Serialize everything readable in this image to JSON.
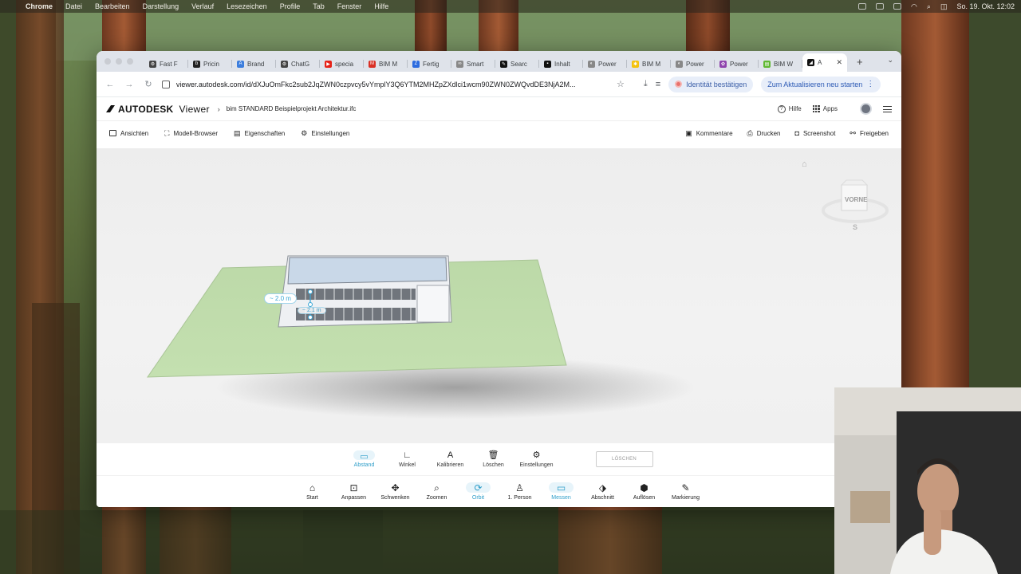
{
  "menubar": {
    "app": "Chrome",
    "items": [
      "Datei",
      "Bearbeiten",
      "Darstellung",
      "Verlauf",
      "Lesezeichen",
      "Profile",
      "Tab",
      "Fenster",
      "Hilfe"
    ],
    "datetime": "So. 19. Okt. 12:02"
  },
  "tabs": [
    {
      "label": "Fast F",
      "color": "#444444",
      "glyph": "⚙"
    },
    {
      "label": "Pricin",
      "color": "#222222",
      "glyph": "b"
    },
    {
      "label": "Brand",
      "color": "#3b7ddd",
      "glyph": "A"
    },
    {
      "label": "ChatG",
      "color": "#444444",
      "glyph": "⚙"
    },
    {
      "label": "specia",
      "color": "#e62117",
      "glyph": "▶"
    },
    {
      "label": "BIM M",
      "color": "#d93025",
      "glyph": "M"
    },
    {
      "label": "Fertig",
      "color": "#2d6cdf",
      "glyph": "Z"
    },
    {
      "label": "Smart",
      "color": "#888888",
      "glyph": "∞"
    },
    {
      "label": "Searc",
      "color": "#111111",
      "glyph": "✎"
    },
    {
      "label": "Inhalt",
      "color": "#111111",
      "glyph": "▪"
    },
    {
      "label": "Power",
      "color": "#888888",
      "glyph": "◐"
    },
    {
      "label": "BIM M",
      "color": "#f4c20d",
      "glyph": "✱"
    },
    {
      "label": "Power",
      "color": "#888888",
      "glyph": "◐"
    },
    {
      "label": "Power",
      "color": "#8e44ad",
      "glyph": "✿"
    },
    {
      "label": "BIM W",
      "color": "#5fb832",
      "glyph": "▤"
    },
    {
      "label": "A",
      "color": "#111111",
      "glyph": "◢"
    }
  ],
  "address": {
    "url": "viewer.autodesk.com/id/dXJuOmFkc2sub2JqZWN0czpvcy5vYmplY3Q6YTM2MHZpZXdlci1wcm90ZWN0ZWQvdDE3NjA2M...",
    "identity_label": "Identität bestätigen",
    "update_label": "Zum Aktualisieren neu starten"
  },
  "viewer": {
    "brand": "AUTODESK",
    "product": "Viewer",
    "filename": "bim STANDARD Beispielprojekt Architektur.ifc",
    "help": "Hilfe",
    "apps": "Apps",
    "toolbar_left": [
      "Ansichten",
      "Modell-Browser",
      "Eigenschaften",
      "Einstellungen"
    ],
    "toolbar_right": [
      "Kommentare",
      "Drucken",
      "Screenshot",
      "Freigeben"
    ],
    "viewcube_face": "VORNE",
    "viewcube_compass": "S",
    "measure_labels": [
      "~ 2.0 m",
      "~ 2.1 m"
    ]
  },
  "measure_toolbar": {
    "buttons": [
      {
        "label": "Abstand",
        "icon": "ruler-icon",
        "glyph": "▭",
        "active": true
      },
      {
        "label": "Winkel",
        "icon": "angle-icon",
        "glyph": "∟",
        "active": false
      },
      {
        "label": "Kalibrieren",
        "icon": "calibrate-icon",
        "glyph": "A",
        "active": false
      },
      {
        "label": "Löschen",
        "icon": "trash-icon",
        "glyph": "🗑",
        "active": false
      },
      {
        "label": "Einstellungen",
        "icon": "gear-icon",
        "glyph": "⚙",
        "active": false
      }
    ],
    "clear_label": "LÖSCHEN"
  },
  "main_toolbar": {
    "buttons": [
      {
        "label": "Start",
        "icon": "home-icon",
        "glyph": "⌂",
        "active": false
      },
      {
        "label": "Anpassen",
        "icon": "fit-icon",
        "glyph": "⊡",
        "active": false
      },
      {
        "label": "Schwenken",
        "icon": "pan-icon",
        "glyph": "✥",
        "active": false
      },
      {
        "label": "Zoomen",
        "icon": "zoom-icon",
        "glyph": "⌕",
        "active": false
      },
      {
        "label": "Orbit",
        "icon": "orbit-icon",
        "glyph": "⟳",
        "active": true
      },
      {
        "label": "1. Person",
        "icon": "person-icon",
        "glyph": "♙",
        "active": false
      },
      {
        "label": "Messen",
        "icon": "measure-icon",
        "glyph": "▭",
        "active": true
      },
      {
        "label": "Abschnitt",
        "icon": "section-icon",
        "glyph": "⬗",
        "active": false
      },
      {
        "label": "Auflösen",
        "icon": "explode-icon",
        "glyph": "⬢",
        "active": false
      },
      {
        "label": "Markierung",
        "icon": "markup-icon",
        "glyph": "✎",
        "active": false
      }
    ]
  }
}
